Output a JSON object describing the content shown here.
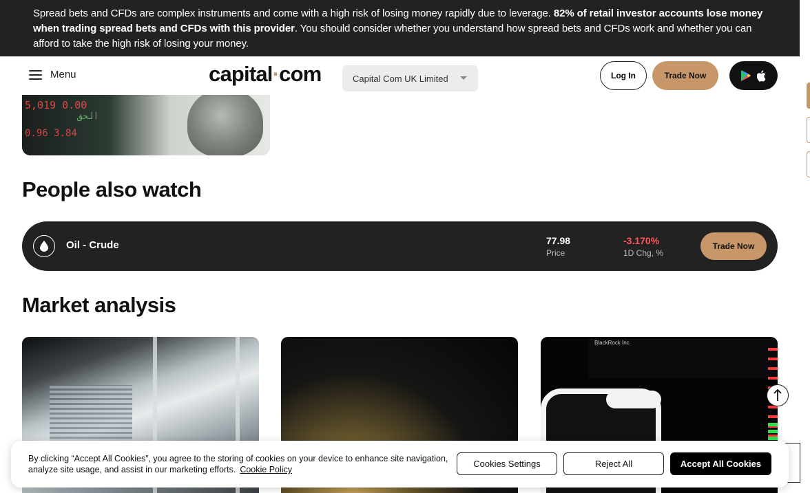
{
  "risk_banner": {
    "text_1": "Spread bets and CFDs are complex instruments and come with a high risk of losing money rapidly due to leverage. ",
    "text_bold": "82% of retail investor accounts lose money when trading spread bets and CFDs with this provider",
    "text_2": ". You should consider whether you understand how spread bets and CFDs work and whether you can afford to take the high risk of losing your money."
  },
  "header": {
    "menu_label": "Menu",
    "logo_left": "capital",
    "logo_dot": "·",
    "logo_right": "com",
    "entity": "Capital Com UK Limited",
    "login_label": "Log In",
    "trade_label": "Trade Now"
  },
  "hero": {
    "ticker_1": "5,019  0.00",
    "ticker_2": "0.96  3.84",
    "ticker_3": "الحق"
  },
  "people_also_watch": {
    "title": "People also watch",
    "items": [
      {
        "name": "Oil - Crude",
        "price": "77.98",
        "price_label": "Price",
        "change": "-3.170%",
        "change_label": "1D Chg, %",
        "trade_label": "Trade Now"
      }
    ]
  },
  "market_analysis": {
    "title": "Market analysis",
    "card_3_screen_text": "BlackRock Inc"
  },
  "cookie": {
    "text": "By clicking “Accept All Cookies”, you agree to the storing of cookies on your device to enhance site navigation, analyze site usage, and assist in our marketing efforts.",
    "policy_link": "Cookie Policy",
    "settings_label": "Cookies Settings",
    "reject_label": "Reject All",
    "accept_label": "Accept All Cookies"
  },
  "colors": {
    "accent": "#c79769",
    "negative": "#ff5757",
    "dark": "#222222"
  }
}
